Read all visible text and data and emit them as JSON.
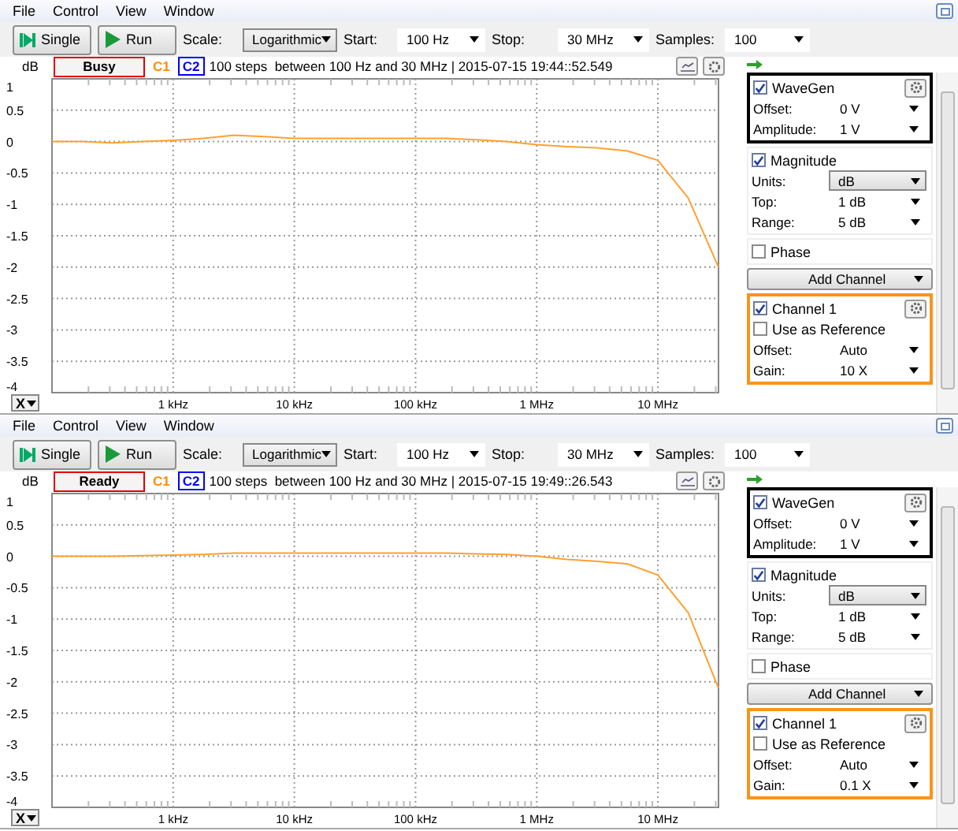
{
  "panels": [
    {
      "menu": [
        "File",
        "Control",
        "View",
        "Window"
      ],
      "toolbar": {
        "single": "Single",
        "run": "Run",
        "scale_label": "Scale:",
        "scale": "Logarithmic",
        "start_label": "Start:",
        "start": "100 Hz",
        "stop_label": "Stop:",
        "stop": "30 MHz",
        "samples_label": "Samples:",
        "samples": "100"
      },
      "status": "Busy",
      "channels": [
        {
          "label": "C1",
          "color": "#ff8c00"
        },
        {
          "label": "C2",
          "color": "#0000ff"
        }
      ],
      "info": "100 steps  between 100 Hz and 30 MHz | 2015-07-15 19:44::52.549",
      "axis_menu": "X",
      "chart_data": {
        "type": "line",
        "ylabel": "dB",
        "categories": [
          null,
          null,
          null,
          null,
          "1 kHz",
          null,
          null,
          null,
          "10 kHz",
          null,
          null,
          null,
          "100 kHz",
          null,
          null,
          null,
          "1 MHz",
          null,
          null,
          null,
          "10 MHz",
          null,
          null
        ],
        "grid": true,
        "series": [
          {
            "color": "#ffa030",
            "values": [
              0,
              0,
              -0.02,
              0,
              0.02,
              0.05,
              0.1,
              0.08,
              0.05,
              0.05,
              0.05,
              0.05,
              0.05,
              0.05,
              0.03,
              0,
              -0.05,
              -0.08,
              -0.1,
              -0.15,
              -0.3,
              -0.9,
              -2.0
            ]
          }
        ],
        "ylim": [
          -4,
          1
        ],
        "yticks": [
          1,
          0.5,
          0,
          -0.5,
          -1,
          -1.5,
          -2,
          -2.5,
          -3,
          -3.5,
          -4
        ]
      },
      "side": {
        "wavegen": {
          "label": "WaveGen",
          "checked": true,
          "offset_label": "Offset:",
          "offset": "0 V",
          "amplitude_label": "Amplitude:",
          "amplitude": "1 V"
        },
        "magnitude": {
          "label": "Magnitude",
          "checked": true,
          "units_label": "Units:",
          "units": "dB",
          "top_label": "Top:",
          "top": "1 dB",
          "range_label": "Range:",
          "range": "5 dB"
        },
        "phase": {
          "label": "Phase",
          "checked": false
        },
        "add_channel": "Add Channel",
        "channel": {
          "label": "Channel 1",
          "checked": true,
          "reference": {
            "label": "Use as Reference",
            "checked": false
          },
          "offset_label": "Offset:",
          "offset": "Auto",
          "gain_label": "Gain:",
          "gain": "10 X"
        }
      }
    },
    {
      "menu": [
        "File",
        "Control",
        "View",
        "Window"
      ],
      "toolbar": {
        "single": "Single",
        "run": "Run",
        "scale_label": "Scale:",
        "scale": "Logarithmic",
        "start_label": "Start:",
        "start": "100 Hz",
        "stop_label": "Stop:",
        "stop": "30 MHz",
        "samples_label": "Samples:",
        "samples": "100"
      },
      "status": "Ready",
      "channels": [
        {
          "label": "C1",
          "color": "#ff8c00"
        },
        {
          "label": "C2",
          "color": "#0000ff"
        }
      ],
      "info": "100 steps  between 100 Hz and 30 MHz | 2015-07-15 19:49::26.543",
      "axis_menu": "X",
      "chart_data": {
        "type": "line",
        "ylabel": "dB",
        "categories": [
          null,
          null,
          null,
          null,
          "1 kHz",
          null,
          null,
          null,
          "10 kHz",
          null,
          null,
          null,
          "100 kHz",
          null,
          null,
          null,
          "1 MHz",
          null,
          null,
          null,
          "10 MHz",
          null,
          null
        ],
        "grid": true,
        "series": [
          {
            "color": "#ffa030",
            "values": [
              0,
              0,
              0,
              0.01,
              0.02,
              0.03,
              0.05,
              0.05,
              0.05,
              0.05,
              0.05,
              0.05,
              0.05,
              0.05,
              0.04,
              0.03,
              0,
              -0.05,
              -0.08,
              -0.12,
              -0.3,
              -0.9,
              -2.1
            ]
          }
        ],
        "ylim": [
          -4,
          1
        ],
        "yticks": [
          1,
          0.5,
          0,
          -0.5,
          -1,
          -1.5,
          -2,
          -2.5,
          -3,
          -3.5,
          -4
        ]
      },
      "side": {
        "wavegen": {
          "label": "WaveGen",
          "checked": true,
          "offset_label": "Offset:",
          "offset": "0 V",
          "amplitude_label": "Amplitude:",
          "amplitude": "1 V"
        },
        "magnitude": {
          "label": "Magnitude",
          "checked": true,
          "units_label": "Units:",
          "units": "dB",
          "top_label": "Top:",
          "top": "1 dB",
          "range_label": "Range:",
          "range": "5 dB"
        },
        "phase": {
          "label": "Phase",
          "checked": false
        },
        "add_channel": "Add Channel",
        "channel": {
          "label": "Channel 1",
          "checked": true,
          "reference": {
            "label": "Use as Reference",
            "checked": false
          },
          "offset_label": "Offset:",
          "offset": "Auto",
          "gain_label": "Gain:",
          "gain": "0.1 X"
        }
      }
    }
  ]
}
